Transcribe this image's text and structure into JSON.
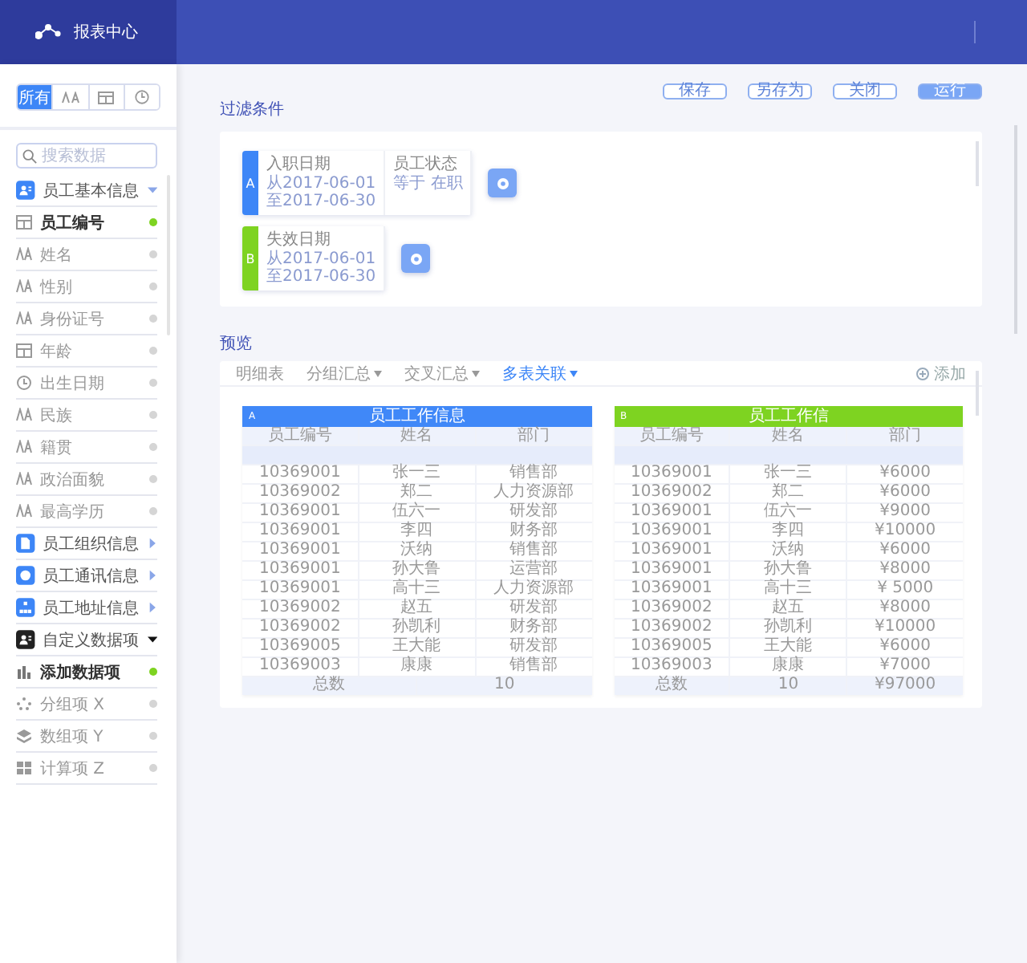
{
  "header": {
    "title": "报表中心"
  },
  "sidebar": {
    "tabs": [
      {
        "kind": "label",
        "label": "所有",
        "selected": true
      },
      {
        "kind": "text-icon",
        "selected": false
      },
      {
        "kind": "table-icon",
        "selected": false
      },
      {
        "kind": "clock-icon",
        "selected": false
      }
    ],
    "search": {
      "placeholder": "搜索数据"
    },
    "groups": [
      {
        "kind": "person",
        "title": "员工基本信息",
        "expanded": true,
        "items": [
          {
            "kind": "table",
            "label": "员工编号",
            "selected": true
          },
          {
            "kind": "text",
            "label": "姓名",
            "selected": false
          },
          {
            "kind": "text",
            "label": "性别",
            "selected": false
          },
          {
            "kind": "text",
            "label": "身份证号",
            "selected": false
          },
          {
            "kind": "table",
            "label": "年龄",
            "selected": false
          },
          {
            "kind": "clock",
            "label": "出生日期",
            "selected": false
          },
          {
            "kind": "text",
            "label": "民族",
            "selected": false
          },
          {
            "kind": "text",
            "label": "籍贯",
            "selected": false
          },
          {
            "kind": "text",
            "label": "政治面貌",
            "selected": false
          },
          {
            "kind": "text",
            "label": "最高学历",
            "selected": false
          }
        ]
      },
      {
        "kind": "doc",
        "title": "员工组织信息",
        "expanded": false
      },
      {
        "kind": "circle",
        "title": "员工通讯信息",
        "expanded": false
      },
      {
        "kind": "tree",
        "title": "员工地址信息",
        "expanded": false
      },
      {
        "kind": "custom",
        "title": "自定义数据项",
        "expanded": true,
        "items": [
          {
            "kind": "chart",
            "label": "添加数据项",
            "selected": true
          },
          {
            "kind": "scatter",
            "label": "分组项 X",
            "selected": false
          },
          {
            "kind": "stack",
            "label": "数组项 Y",
            "selected": false
          },
          {
            "kind": "grid",
            "label": "计算项 Z",
            "selected": false
          }
        ]
      }
    ]
  },
  "filters": {
    "title": "过滤条件",
    "buttons": [
      {
        "label": "保存",
        "primary": false
      },
      {
        "label": "另存为",
        "primary": false
      },
      {
        "label": "关闭",
        "primary": false
      },
      {
        "label": "运行",
        "primary": true
      }
    ],
    "groups": [
      {
        "letter": "A",
        "color": "#3d86f7",
        "conditions": [
          {
            "field": "入职日期",
            "lines": [
              "从2017-06-01",
              "至2017-06-30"
            ]
          },
          {
            "field": "员工状态",
            "lines": [
              "等于 在职"
            ]
          }
        ]
      },
      {
        "letter": "B",
        "color": "#7ed321",
        "conditions": [
          {
            "field": "失效日期",
            "lines": [
              "从2017-06-01",
              "至2017-06-30"
            ]
          }
        ]
      }
    ]
  },
  "preview": {
    "title": "预览",
    "tabs": [
      {
        "label": "明细表",
        "dropdown": false,
        "selected": false
      },
      {
        "label": "分组汇总",
        "dropdown": true,
        "selected": false
      },
      {
        "label": "交叉汇总",
        "dropdown": true,
        "selected": false
      },
      {
        "label": "多表关联",
        "dropdown": true,
        "selected": true
      }
    ],
    "add": "添加",
    "tables": [
      {
        "tag": "A",
        "title": "员工工作信息",
        "color": "#4088f8",
        "columns": [
          "员工编号",
          "姓名",
          "部门"
        ],
        "rows": [
          [
            "10369001",
            "张一三",
            "销售部"
          ],
          [
            "10369002",
            "郑二",
            "人力资源部"
          ],
          [
            "10369001",
            "伍六一",
            "研发部"
          ],
          [
            "10369001",
            "李四",
            "财务部"
          ],
          [
            "10369001",
            "沃纳",
            "销售部"
          ],
          [
            "10369001",
            "孙大鲁",
            "运营部"
          ],
          [
            "10369001",
            "高十三",
            "人力资源部"
          ],
          [
            "10369002",
            "赵五",
            "研发部"
          ],
          [
            "10369002",
            "孙凯利",
            "财务部"
          ],
          [
            "10369005",
            "王大能",
            "研发部"
          ],
          [
            "10369003",
            "康康",
            "销售部"
          ]
        ],
        "footer": [
          "总数",
          "10"
        ]
      },
      {
        "tag": "B",
        "title": "员工工作信",
        "color": "#7ed321",
        "columns": [
          "员工编号",
          "姓名",
          "部门"
        ],
        "rows": [
          [
            "10369001",
            "张一三",
            "¥6000"
          ],
          [
            "10369002",
            "郑二",
            "¥6000"
          ],
          [
            "10369001",
            "伍六一",
            "¥9000"
          ],
          [
            "10369001",
            "李四",
            "¥10000"
          ],
          [
            "10369001",
            "沃纳",
            "¥6000"
          ],
          [
            "10369001",
            "孙大鲁",
            "¥8000"
          ],
          [
            "10369001",
            "高十三",
            "¥ 5000"
          ],
          [
            "10369002",
            "赵五",
            "¥8000"
          ],
          [
            "10369002",
            "孙凯利",
            "¥10000"
          ],
          [
            "10369005",
            "王大能",
            "¥6000"
          ],
          [
            "10369003",
            "康康",
            "¥7000"
          ]
        ],
        "footer": [
          "总数",
          "10",
          "¥97000"
        ]
      }
    ]
  }
}
